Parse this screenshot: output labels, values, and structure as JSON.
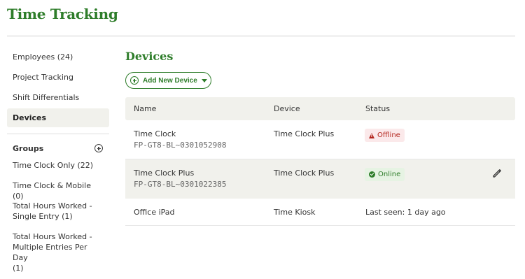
{
  "app": {
    "title": "Time Tracking"
  },
  "sidebar": {
    "items": [
      {
        "label": "Employees (24)"
      },
      {
        "label": "Project Tracking"
      },
      {
        "label": "Shift Differentials"
      },
      {
        "label": "Devices"
      }
    ],
    "groups_title": "Groups",
    "groups": [
      {
        "line1": "Time Clock Only (22)"
      },
      {
        "line1": "Time Clock & Mobile (0)"
      },
      {
        "line1": "Total Hours Worked -",
        "line2": "Single Entry (1)"
      },
      {
        "line1": "Total Hours Worked -",
        "line2": "Multiple Entries Per Day",
        "line3": "(1)"
      }
    ]
  },
  "main": {
    "title": "Devices",
    "add_button_label": "Add New Device",
    "columns": {
      "name": "Name",
      "device": "Device",
      "status": "Status"
    },
    "rows": [
      {
        "name": "Time Clock",
        "serial": "FP-GT8-BL~0301052908",
        "device": "Time Clock Plus",
        "status": "Offline"
      },
      {
        "name": "Time Clock Plus",
        "serial": "FP-GT8-BL~0301022385",
        "device": "Time Clock Plus",
        "status": "Online"
      },
      {
        "name": "Office iPad",
        "device": "Time Kiosk",
        "status": "Last seen: 1 day ago"
      }
    ]
  },
  "colors": {
    "brand_green": "#2e7d2a",
    "offline_red": "#b3261e",
    "header_bg": "#f1f1ec"
  },
  "icons": [
    "plus-circle-icon",
    "caret-down-icon",
    "warning-icon",
    "check-circle-icon",
    "pencil-icon"
  ]
}
